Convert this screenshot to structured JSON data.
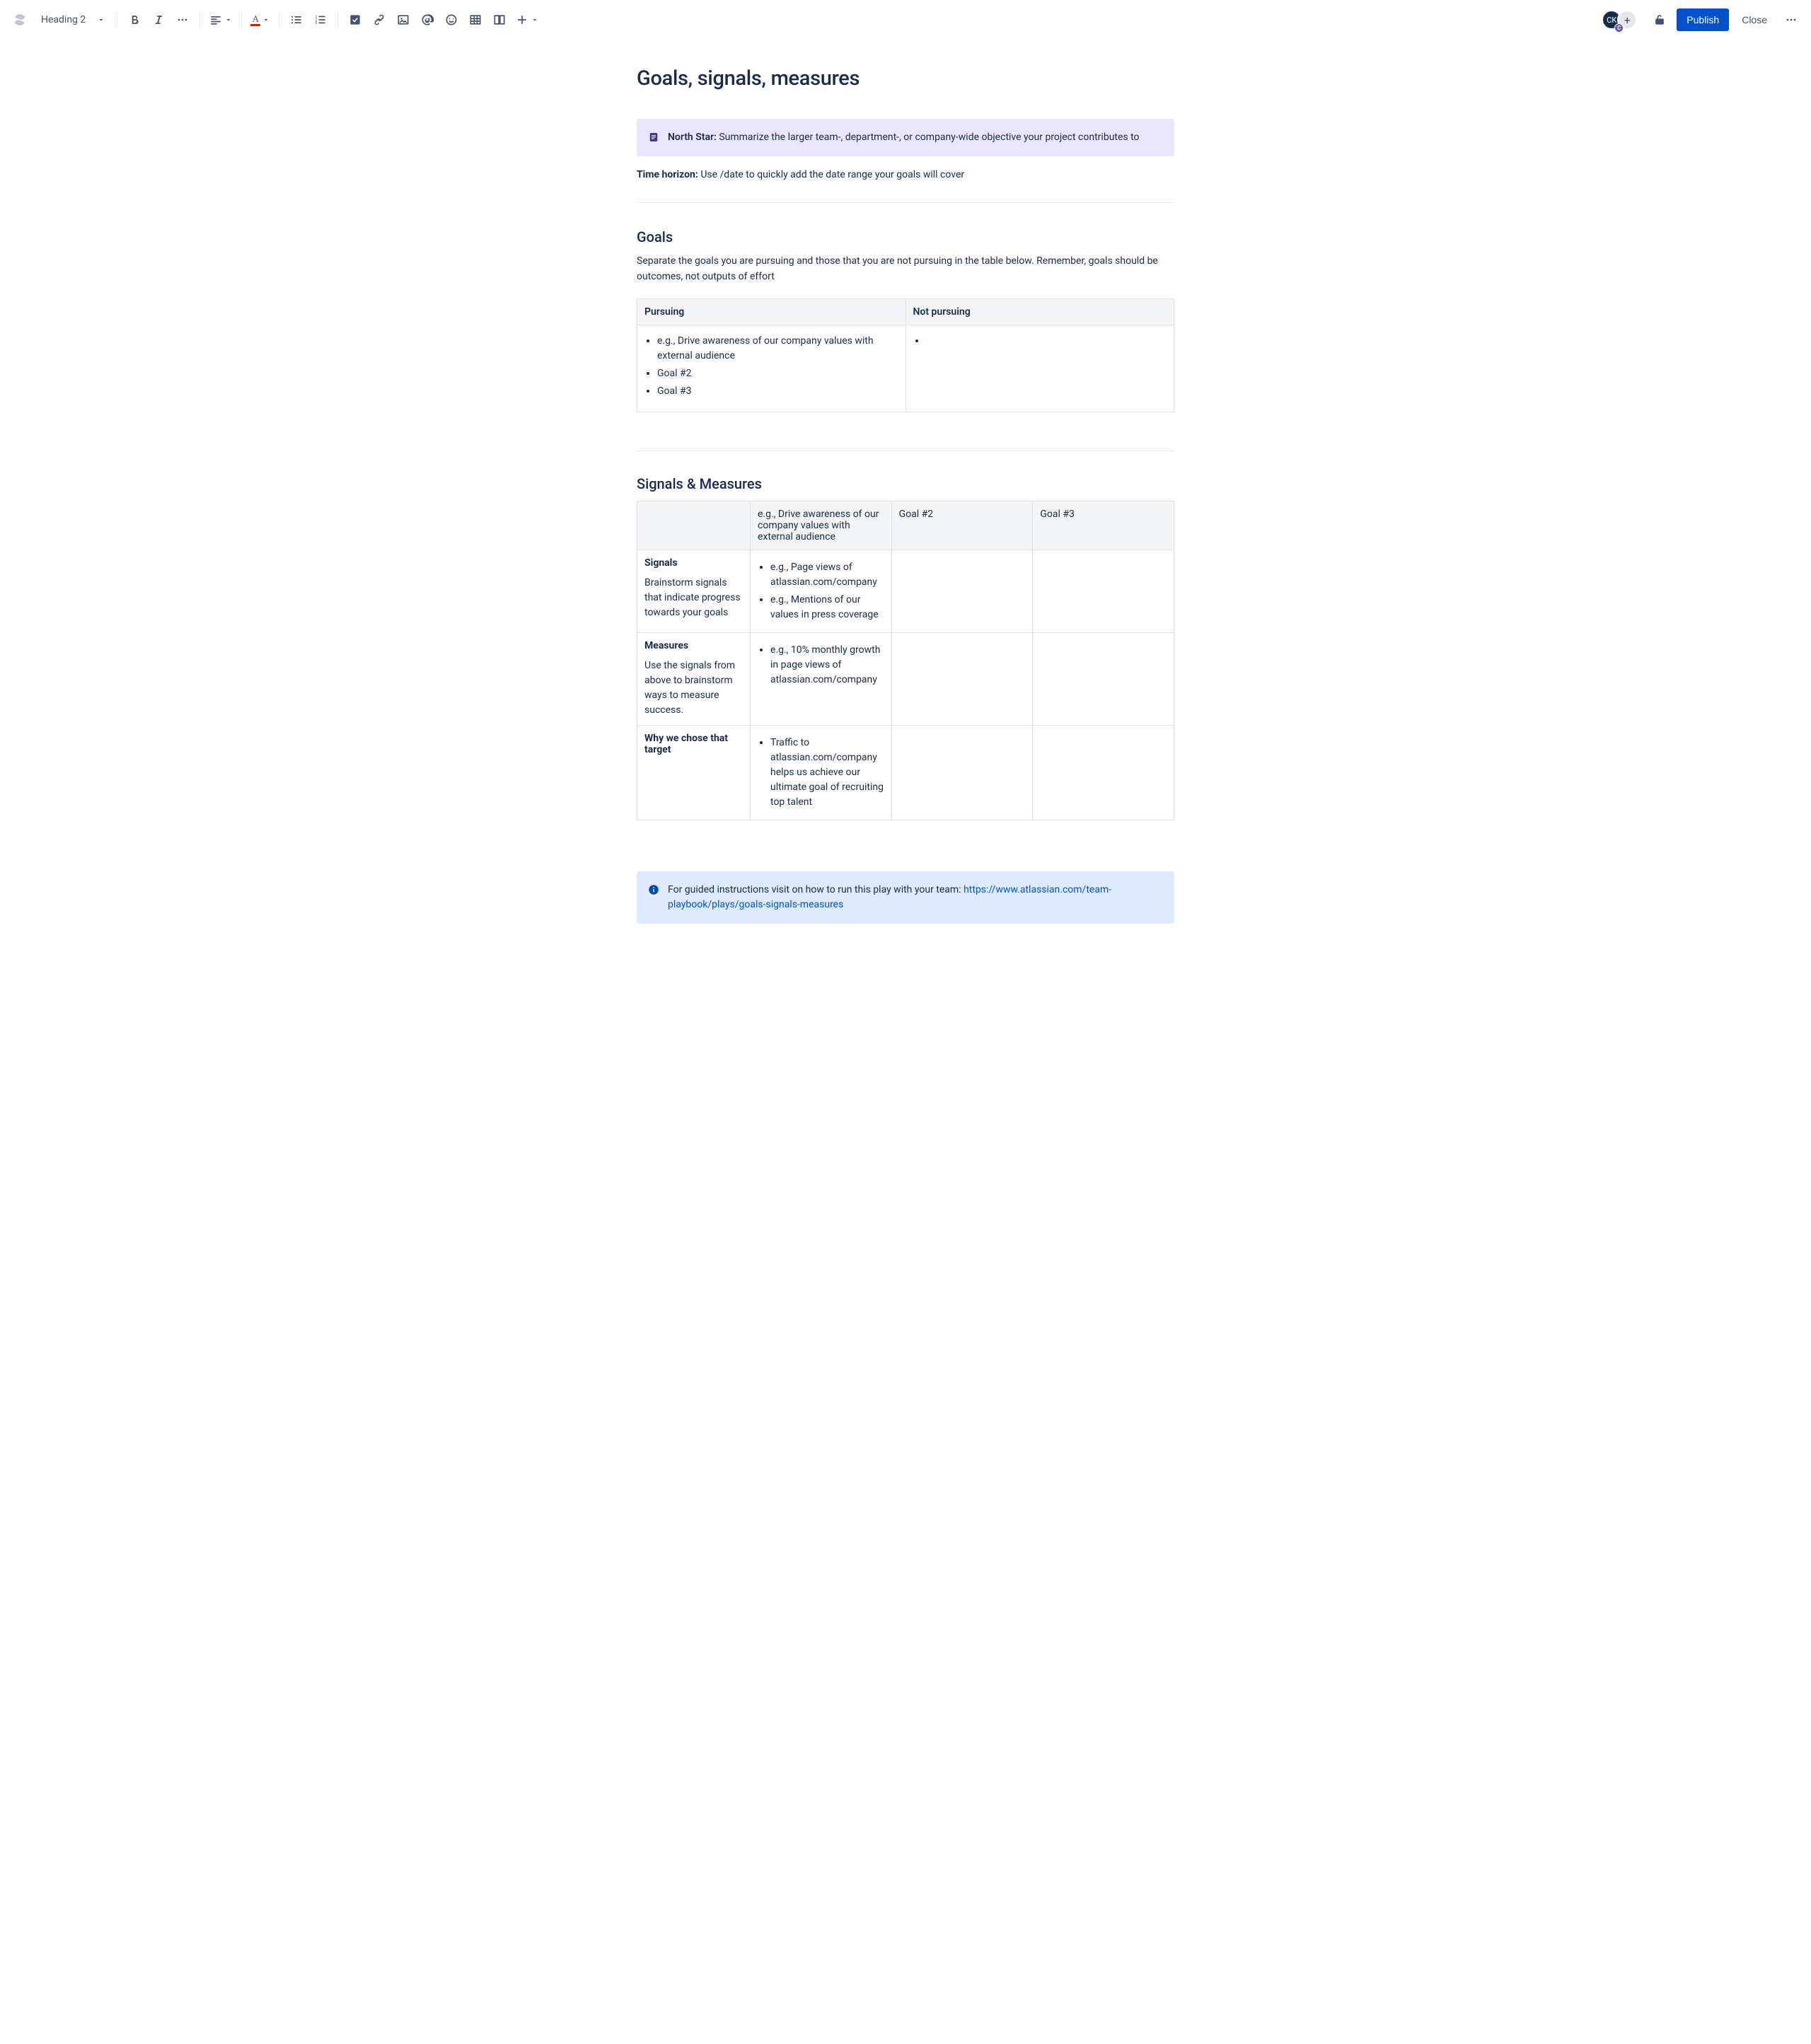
{
  "toolbar": {
    "heading_select": "Heading 2",
    "publish_label": "Publish",
    "close_label": "Close"
  },
  "user": {
    "initials": "CK",
    "badge": "C"
  },
  "page": {
    "title": "Goals, signals, measures"
  },
  "north_star": {
    "label": "North Star:",
    "text": "Summarize the larger team-, department-, or company-wide objective your project contributes to"
  },
  "time_horizon": {
    "label": "Time horizon:",
    "text": "Use /date to quickly add the date range your goals will cover"
  },
  "goals": {
    "heading": "Goals",
    "description": "Separate the goals you are pursuing and those that you are not pursuing in the table below. Remember, goals should be outcomes, not outputs of effort",
    "col_pursuing": "Pursuing",
    "col_not_pursuing": "Not pursuing",
    "pursuing_items": {
      "0": "e.g., Drive awareness of our company values with external audience",
      "1": "Goal #2",
      "2": "Goal #3"
    }
  },
  "sm": {
    "heading": "Signals & Measures",
    "head_col1": "e.g., Drive awareness of our company values with external audience",
    "head_col2": "Goal #2",
    "head_col3": "Goal #3",
    "row_signals_label": "Signals",
    "row_signals_sub": "Brainstorm signals that indicate progress towards your goals",
    "signals_items": {
      "0": "e.g., Page views of atlassian.com/company",
      "1": "e.g., Mentions of our values in press coverage"
    },
    "row_measures_label": "Measures",
    "row_measures_sub": "Use the signals from above to brainstorm ways to measure success.",
    "measures_items": {
      "0": "e.g., 10% monthly growth in page views of atlassian.com/company"
    },
    "row_why_label": "Why we chose that target",
    "why_items": {
      "0": "Traffic to atlassian.com/company helps us achieve our ultimate goal of recruiting top talent"
    }
  },
  "info_panel": {
    "text": "For guided instructions visit on how to run this play with your team: ",
    "link_text": "https://www.atlassian.com/team-playbook/plays/goals-signals-measures",
    "link_href": "https://www.atlassian.com/team-playbook/plays/goals-signals-measures"
  }
}
